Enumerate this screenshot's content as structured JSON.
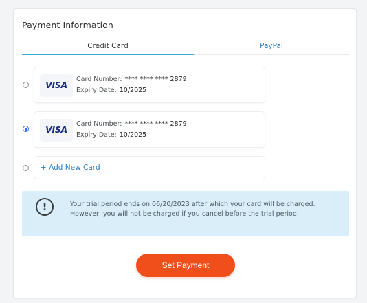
{
  "panel": {
    "title": "Payment Information"
  },
  "tabs": [
    {
      "label": "Credit Card",
      "active": true
    },
    {
      "label": "PayPal",
      "active": false
    }
  ],
  "cards": [
    {
      "brand": "VISA",
      "number_label": "Card Number:",
      "number": "**** **** **** 2879",
      "expiry_label": "Expiry Date:",
      "expiry": "10/2025",
      "selected": false
    },
    {
      "brand": "VISA",
      "number_label": "Card Number:",
      "number": "**** **** **** 2879",
      "expiry_label": "Expiry Date:",
      "expiry": "10/2025",
      "selected": true
    }
  ],
  "add_card": {
    "label": "+ Add New Card",
    "selected": false
  },
  "notice": {
    "icon": "exclamation-circle-icon",
    "text": "Your trial period ends on 06/20/2023 after which your card will be charged. However, you will not be charged if you cancel before the trial period."
  },
  "action": {
    "label": "Set Payment"
  },
  "colors": {
    "accent": "#3aa8d2",
    "link": "#2f7fbf",
    "button": "#f04f1c",
    "notice_bg": "#d9eef8",
    "radio_selected": "#2f6fe0",
    "visa": "#1a2c7a"
  }
}
